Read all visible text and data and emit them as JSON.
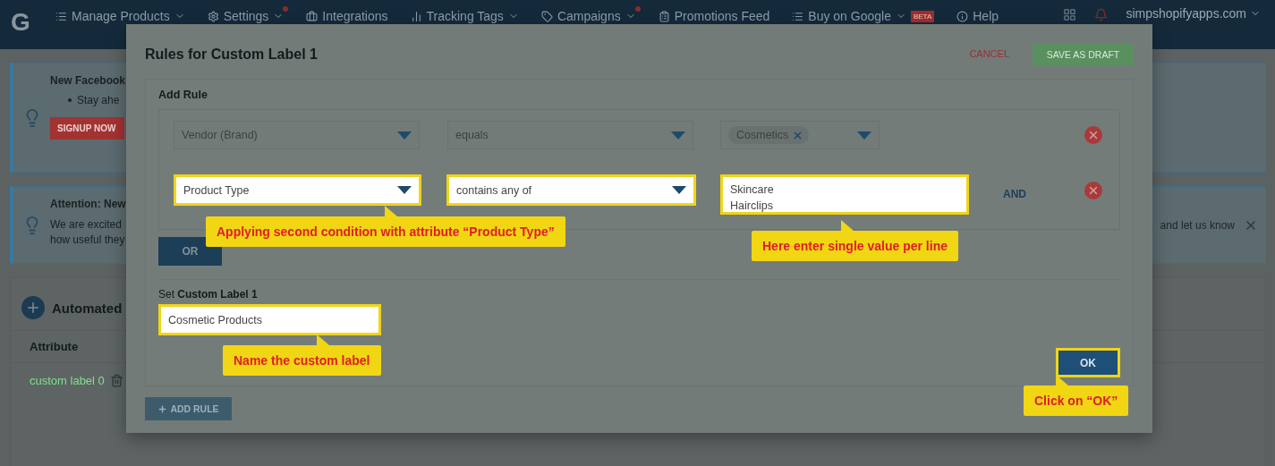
{
  "navbar": {
    "logo": "G",
    "items": [
      {
        "label": "Manage Products",
        "dropdown": true,
        "dot": false
      },
      {
        "label": "Settings",
        "dropdown": true,
        "dot": true
      },
      {
        "label": "Integrations",
        "dropdown": false,
        "dot": false
      },
      {
        "label": "Tracking Tags",
        "dropdown": true,
        "dot": false
      },
      {
        "label": "Campaigns",
        "dropdown": true,
        "dot": true
      },
      {
        "label": "Promotions Feed",
        "dropdown": false,
        "dot": false
      },
      {
        "label": "Buy on Google",
        "dropdown": true,
        "dot": false,
        "badge": "BETA"
      },
      {
        "label": "Help",
        "dropdown": false,
        "dot": false
      }
    ],
    "account": "simpshopifyapps.com"
  },
  "notice_facebook": {
    "title": "New Facebook",
    "bullet": "Stay ahe",
    "button": "SIGNUP NOW"
  },
  "notice_attention": {
    "title": "Attention: New",
    "lines": [
      "We are excited",
      "how useful they"
    ],
    "tail": "and let us know"
  },
  "automated": {
    "title": "Automated",
    "column": "Attribute",
    "row": "custom label 0"
  },
  "modal": {
    "title": "Rules for Custom Label 1",
    "cancel": "CANCEL",
    "save": "SAVE AS DRAFT",
    "section": "Add Rule",
    "conditions": [
      {
        "attribute": "Vendor (Brand)",
        "operator": "equals",
        "kind": "tags",
        "values": [
          "Cosmetics"
        ],
        "highlighted": false
      },
      {
        "attribute": "Product Type",
        "operator": "contains any of",
        "kind": "lines",
        "values": [
          "Skincare",
          "Hairclips"
        ],
        "connector": "AND",
        "highlighted": true,
        "attribute_note": "Applying second condition with attribute “Product Type”",
        "values_note": "Here enter single value per line"
      }
    ],
    "or_button": "OR",
    "label_prompt": "Set **Custom Label 1**",
    "label_value": "Cosmetic Products",
    "label_highlighted": true,
    "label_note": "Name the custom label",
    "ok": "OK",
    "ok_highlighted": true,
    "ok_note": "Click on “OK”",
    "add_rule": "ADD RULE"
  }
}
